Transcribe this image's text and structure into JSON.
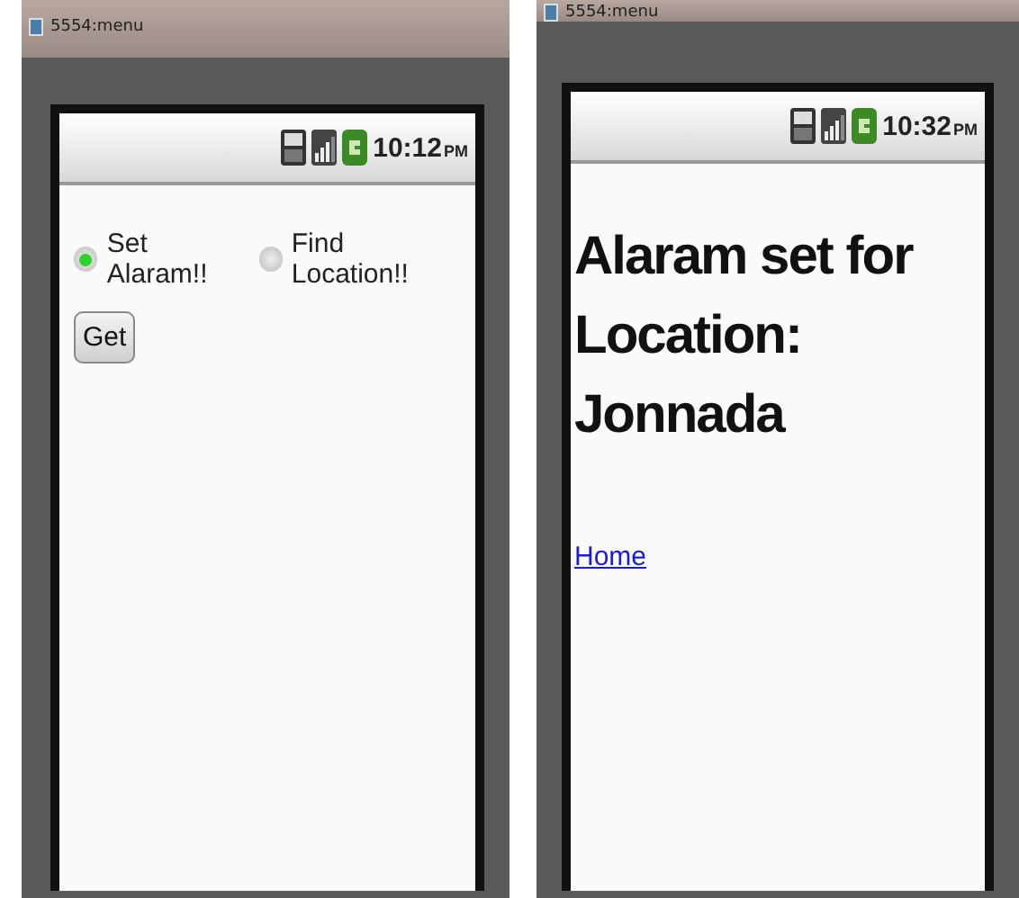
{
  "windows": [
    {
      "title": "5554:menu",
      "status_bar": {
        "time": "10:12",
        "meridiem": "PM"
      },
      "screen": {
        "kind": "form",
        "radios": [
          {
            "label": "Set Alaram!!",
            "selected": true
          },
          {
            "label": "Find Location!!",
            "selected": false
          }
        ],
        "button": "Get"
      }
    },
    {
      "title": "5554:menu",
      "status_bar": {
        "time": "10:32",
        "meridiem": "PM"
      },
      "screen": {
        "kind": "page",
        "heading": "Alaram set for Location: Jonnada",
        "link": "Home"
      }
    }
  ]
}
